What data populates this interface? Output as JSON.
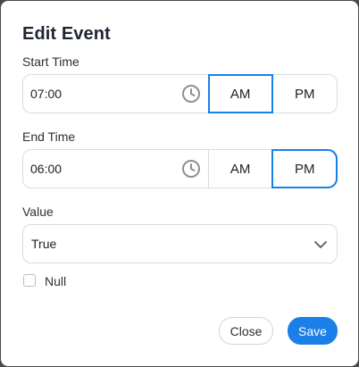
{
  "dialog": {
    "title": "Edit Event"
  },
  "start_time": {
    "label": "Start Time",
    "value": "07:00",
    "am_label": "AM",
    "pm_label": "PM",
    "selected_period": "AM"
  },
  "end_time": {
    "label": "End Time",
    "value": "06:00",
    "am_label": "AM",
    "pm_label": "PM",
    "selected_period": "PM"
  },
  "value_field": {
    "label": "Value",
    "selected": "True"
  },
  "null_option": {
    "label": "Null",
    "checked": false
  },
  "actions": {
    "close_label": "Close",
    "save_label": "Save"
  },
  "colors": {
    "accent": "#1a7fe6",
    "border": "#d8dbe0",
    "icon": "#8a8f97"
  },
  "icons": {
    "start_clock": "clock-icon",
    "end_clock": "clock-icon",
    "value_dropdown": "chevron-down-icon"
  }
}
